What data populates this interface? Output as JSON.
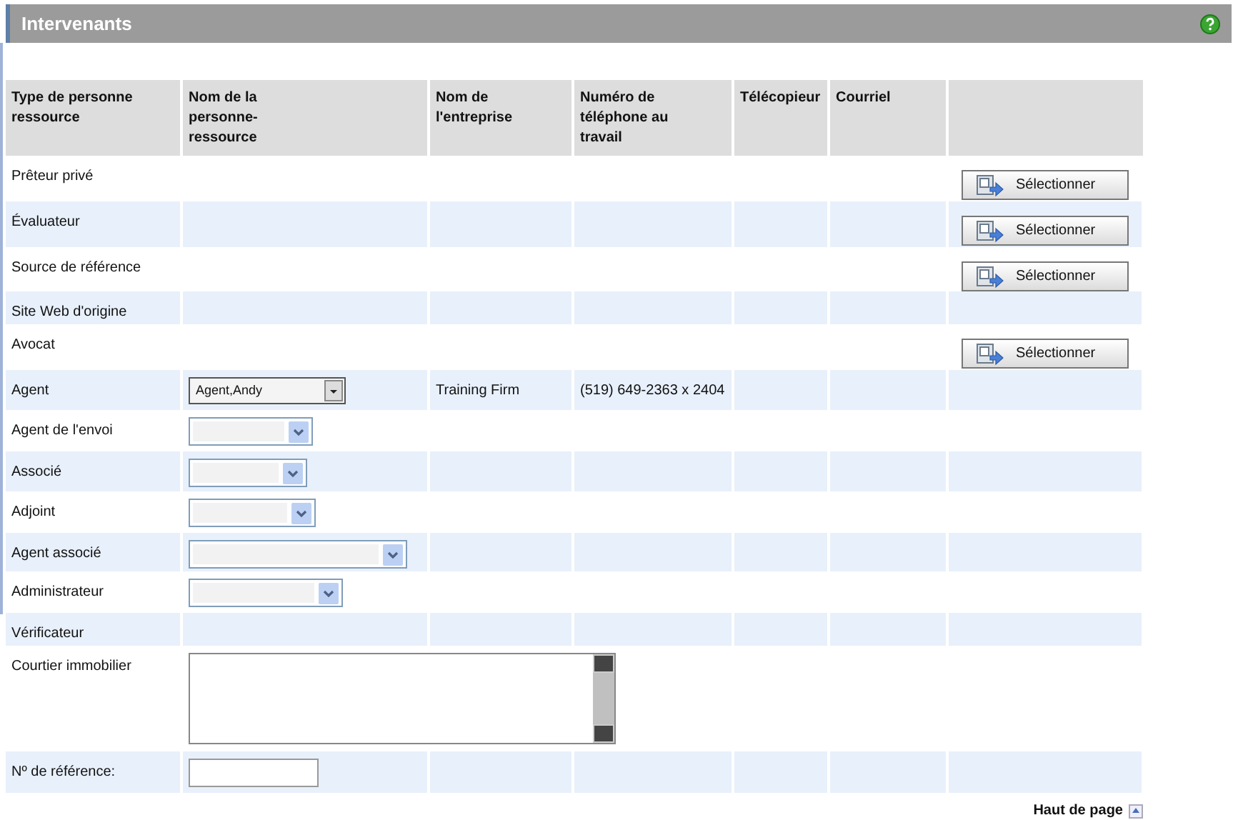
{
  "panel": {
    "title": "Intervenants"
  },
  "table": {
    "columns": [
      "Type de personne ressource",
      "Nom de la personne-ressource",
      "Nom de l'entreprise",
      "Numéro de téléphone au travail",
      "Télécopieur",
      "Courriel"
    ],
    "rows": [
      {
        "label": "Prêteur privé",
        "kind": "button",
        "action": "Sélectionner"
      },
      {
        "label": "Évaluateur",
        "kind": "button",
        "action": "Sélectionner"
      },
      {
        "label": "Source de référence",
        "kind": "button",
        "action": "Sélectionner"
      },
      {
        "label": "Site Web d'origine",
        "kind": "plain"
      },
      {
        "label": "Avocat",
        "kind": "button",
        "action": "Sélectionner"
      },
      {
        "label": "Agent",
        "kind": "combo",
        "value": "Agent,Andy",
        "company": "Training Firm",
        "phone": "(519) 649-2363 x 2404"
      },
      {
        "label": "Agent de l'envoi",
        "kind": "select"
      },
      {
        "label": "Associé",
        "kind": "select"
      },
      {
        "label": "Adjoint",
        "kind": "select"
      },
      {
        "label": "Agent associé",
        "kind": "select"
      },
      {
        "label": "Administrateur",
        "kind": "select"
      },
      {
        "label": "Vérificateur",
        "kind": "plain"
      },
      {
        "label": "Courtier immobilier",
        "kind": "textarea"
      },
      {
        "label": "Nº de référence:",
        "kind": "input"
      }
    ]
  },
  "back_to_top": "Haut de page"
}
